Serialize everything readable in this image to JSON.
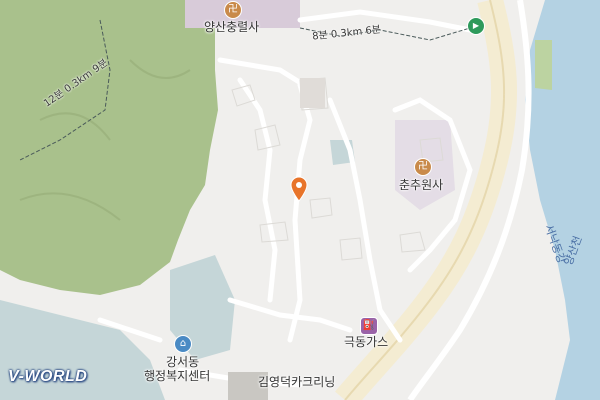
{
  "map": {
    "water_color": "#b4d2e3",
    "forest_color": "#a9c18c",
    "road_color": "#ffffff",
    "trunk_road_color": "#f4ecd2",
    "urban_color": "#c5d6d8"
  },
  "labels": {
    "temple1": "양산충렬사",
    "temple2": "춘추원사",
    "gas": "극동가스",
    "admin_line1": "강서동",
    "admin_line2": "행정복지센터",
    "cleaning": "김영덕카크리닝",
    "river1": "서낙동강",
    "river2": "양산천"
  },
  "trails": {
    "east_trail": "8분 0.3km 6분",
    "west_trail": "12분 0.3km 9분"
  },
  "icons": {
    "temple": "卍",
    "gas": "⛽",
    "admin": "⌂",
    "nav": "▶"
  },
  "brand": {
    "logo": "V-WORLD"
  }
}
